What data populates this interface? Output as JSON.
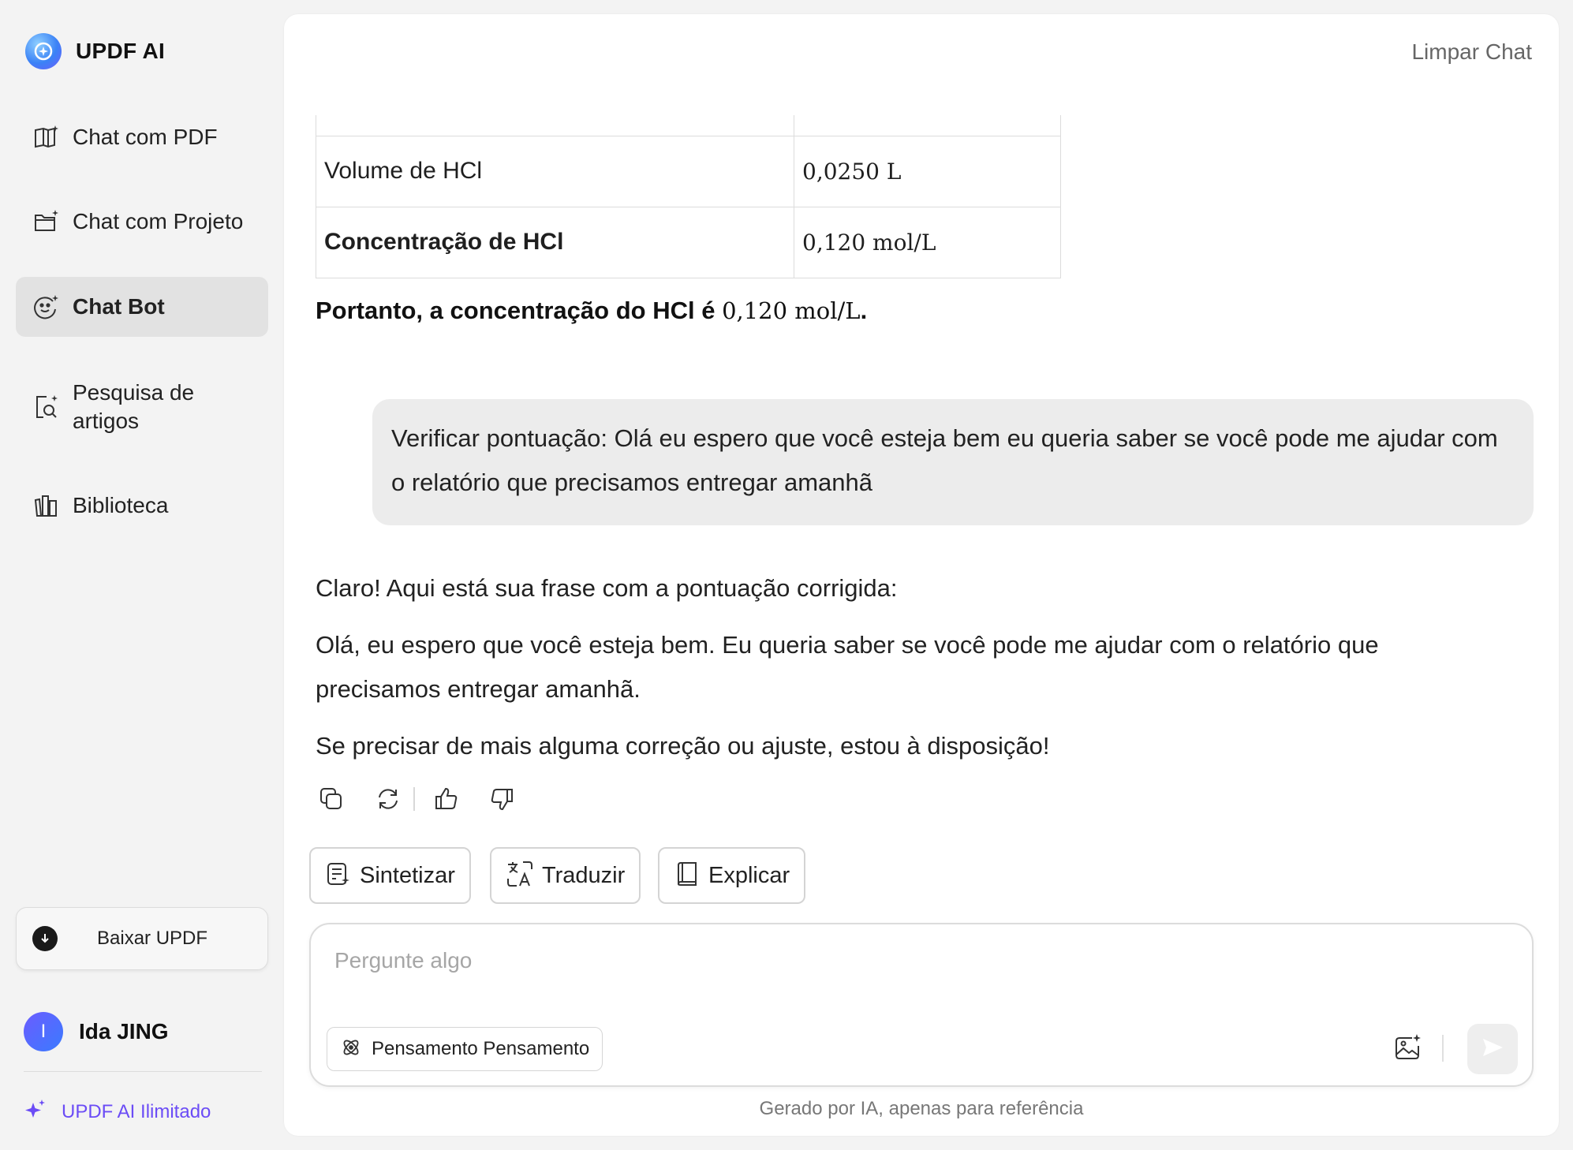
{
  "app": {
    "name": "UPDF AI"
  },
  "sidebar": {
    "items": [
      {
        "label": "Chat com PDF",
        "icon": "book-sparkle-icon"
      },
      {
        "label": "Chat com Projeto",
        "icon": "folder-sparkle-icon"
      },
      {
        "label": "Chat Bot",
        "icon": "bot-face-icon",
        "active": true
      },
      {
        "label": "Pesquisa de artigos",
        "icon": "document-search-icon"
      },
      {
        "label": "Biblioteca",
        "icon": "library-icon"
      }
    ],
    "download_label": "Baixar UPDF",
    "user": {
      "initial": "I",
      "name": "Ida JING"
    },
    "unlimited_label": "UPDF AI Ilimitado"
  },
  "header": {
    "clear_label": "Limpar Chat"
  },
  "table": {
    "rows": [
      {
        "label": "Volume de HCl",
        "value": "0,0250 L"
      },
      {
        "label": "Concentração de HCl",
        "value": "0,120 mol/L"
      }
    ]
  },
  "conclusion": {
    "text": "Portanto, a concentração do HCl é",
    "value": "0,120 mol/L",
    "end": "."
  },
  "user_message": "Verificar pontuação: Olá eu espero que você esteja bem eu queria saber se você pode me ajudar com o relatório que precisamos entregar amanhã",
  "assistant_reply": {
    "intro": "Claro! Aqui está sua frase com a pontuação corrigida:",
    "corrected": "Olá, eu espero que você esteja bem. Eu queria saber se você pode me ajudar com o relatório que precisamos entregar amanhã.",
    "closing": "Se precisar de mais alguma correção ou ajuste, estou à disposição!"
  },
  "quick_actions": [
    {
      "label": "Sintetizar",
      "icon": "summarize-icon"
    },
    {
      "label": "Traduzir",
      "icon": "translate-icon"
    },
    {
      "label": "Explicar",
      "icon": "book-icon"
    }
  ],
  "composer": {
    "placeholder": "Pergunte algo",
    "value": "",
    "think_label": "Pensamento Pensamento"
  },
  "footer": {
    "disclaimer": "Gerado por IA, apenas para referência"
  },
  "colors": {
    "accent": "#6b4cf6",
    "active_bg": "#e2e2e2",
    "bubble_bg": "#ececec"
  }
}
